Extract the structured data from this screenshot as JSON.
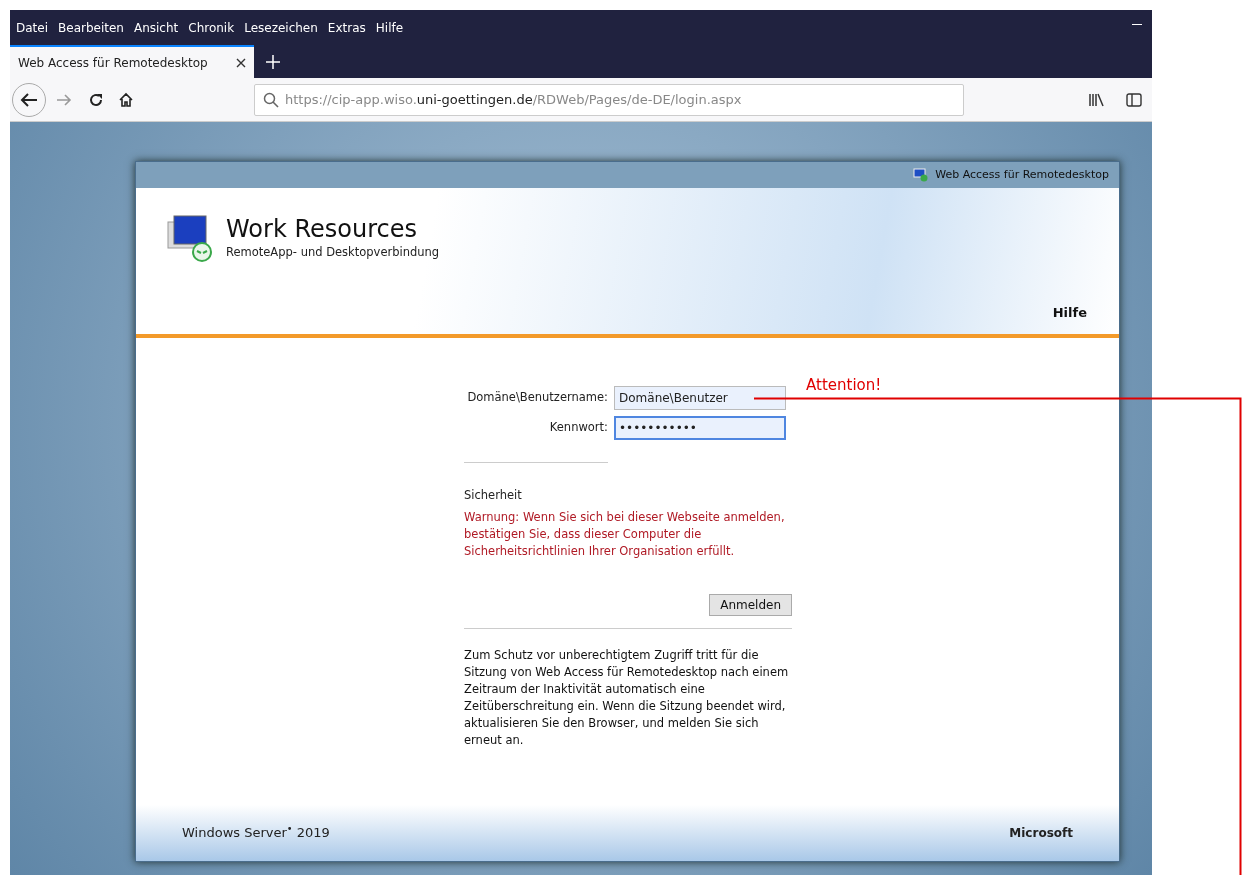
{
  "menu": [
    "Datei",
    "Bearbeiten",
    "Ansicht",
    "Chronik",
    "Lesezeichen",
    "Extras",
    "Hilfe"
  ],
  "tabs": [
    {
      "title": "Web Access für Remotedesktop",
      "selected": true
    }
  ],
  "address": {
    "url_prefix": "https://cip-app.wiso.",
    "url_domain": "uni-goettingen.de",
    "url_path": "/RDWeb/Pages/de-DE/login.aspx"
  },
  "portal": {
    "header_link": "Web Access für Remotedesktop",
    "title": "Work Resources",
    "subtitle": "RemoteApp- und Desktopverbindung",
    "help": "Hilfe",
    "fields": [
      {
        "label": "Domäne\\Benutzername:",
        "value": "Domäne\\Benutzer",
        "focused": false
      },
      {
        "label": "Kennwort:",
        "value": "•••••••••••",
        "focused": true
      }
    ],
    "security_title": "Sicherheit",
    "warning": "Warnung: Wenn Sie sich bei dieser Webseite anmelden, bestätigen Sie, dass dieser Computer die Sicherheitsrichtlinien Ihrer Organisation erfüllt.",
    "submit": "Anmelden",
    "timeout_note": "Zum Schutz vor unberechtigtem Zugriff tritt für die Sitzung von Web Access für Remotedesktop nach einem Zeitraum der Inaktivität automatisch eine Zeitüberschreitung ein. Wenn die Sitzung beendet wird, aktualisieren Sie den Browser, und melden Sie sich erneut an.",
    "footer_left": "Windows Server$^{•}$ 2019",
    "footer_right": "Microsoft"
  },
  "annotation": {
    "text": "Attention!"
  }
}
